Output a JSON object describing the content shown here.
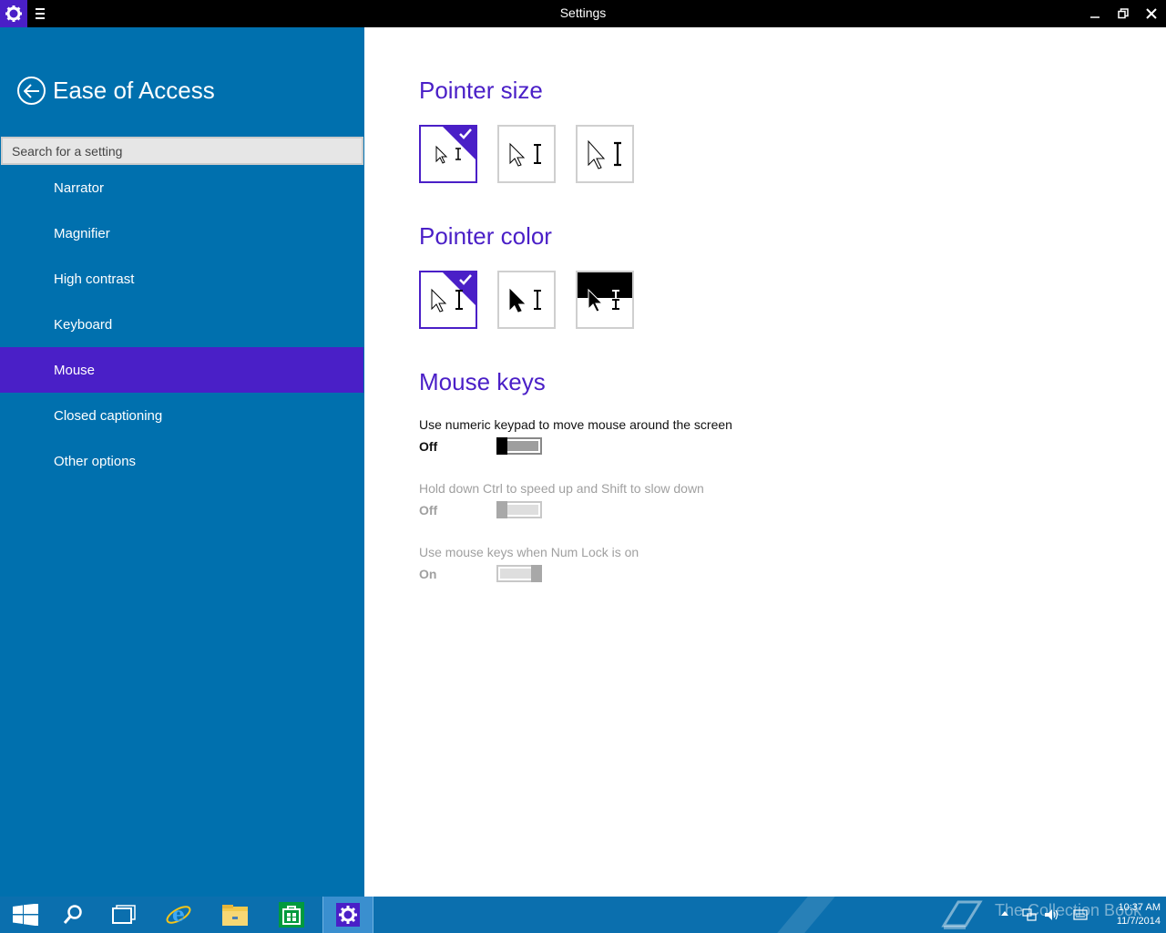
{
  "window": {
    "title": "Settings",
    "minimize_glyph": "–",
    "maximize_glyph": "❐",
    "close_glyph": "✕"
  },
  "sidebar": {
    "section_title": "Ease of Access",
    "search_placeholder": "Search for a setting",
    "items": [
      {
        "label": "Narrator",
        "active": false
      },
      {
        "label": "Magnifier",
        "active": false
      },
      {
        "label": "High contrast",
        "active": false
      },
      {
        "label": "Keyboard",
        "active": false
      },
      {
        "label": "Mouse",
        "active": true
      },
      {
        "label": "Closed captioning",
        "active": false
      },
      {
        "label": "Other options",
        "active": false
      }
    ]
  },
  "main": {
    "pointer_size": {
      "heading": "Pointer size",
      "options": [
        {
          "name": "small",
          "selected": true
        },
        {
          "name": "medium",
          "selected": false
        },
        {
          "name": "large",
          "selected": false
        }
      ]
    },
    "pointer_color": {
      "heading": "Pointer color",
      "options": [
        {
          "name": "white",
          "selected": true
        },
        {
          "name": "black",
          "selected": false
        },
        {
          "name": "inverted",
          "selected": false
        }
      ]
    },
    "mouse_keys": {
      "heading": "Mouse keys",
      "settings": [
        {
          "label": "Use numeric keypad to move mouse around the screen",
          "state": "Off",
          "on": false,
          "enabled": true
        },
        {
          "label": "Hold down Ctrl to speed up and Shift to slow down",
          "state": "Off",
          "on": false,
          "enabled": false
        },
        {
          "label": "Use mouse keys when Num Lock is on",
          "state": "On",
          "on": true,
          "enabled": false
        }
      ]
    }
  },
  "taskbar": {
    "time": "10:37 AM",
    "date": "11/7/2014",
    "watermark": "The Collection Book",
    "items": [
      "start-icon",
      "search-icon",
      "task-view-icon",
      "internet-explorer-icon",
      "file-explorer-icon",
      "store-icon",
      "settings-icon"
    ]
  },
  "colors": {
    "accent": "#4a1fc7",
    "sidebar": "#0070ae",
    "taskbar": "#0b6fae"
  }
}
